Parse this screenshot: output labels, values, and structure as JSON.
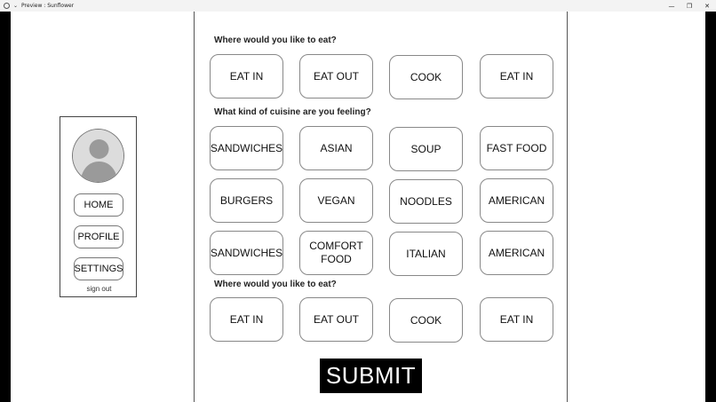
{
  "window": {
    "title": "Preview : Sunflower",
    "controls": {
      "minimize": "—",
      "restore": "❐",
      "close": "✕"
    },
    "menu_chevron": "⌄"
  },
  "sidebar": {
    "home_label": "HOME",
    "profile_label": "PROFILE",
    "settings_label": "SETTINGS",
    "signout_label": "sign out"
  },
  "section1": {
    "title": "Where would you like to eat?",
    "options": [
      "EAT IN",
      "EAT OUT",
      "COOK",
      "EAT IN"
    ]
  },
  "section2": {
    "title": "What kind of cuisine are you feeling?",
    "options": [
      "SANDWICHES",
      "ASIAN",
      "SOUP",
      "FAST FOOD",
      "BURGERS",
      "VEGAN",
      "NOODLES",
      "AMERICAN",
      "SANDWICHES",
      "COMFORT FOOD",
      "ITALIAN",
      "AMERICAN"
    ]
  },
  "section3": {
    "title": "Where would you like to eat?",
    "options": [
      "EAT IN",
      "EAT OUT",
      "COOK",
      "EAT IN"
    ]
  },
  "submit_label": "SUBMIT"
}
